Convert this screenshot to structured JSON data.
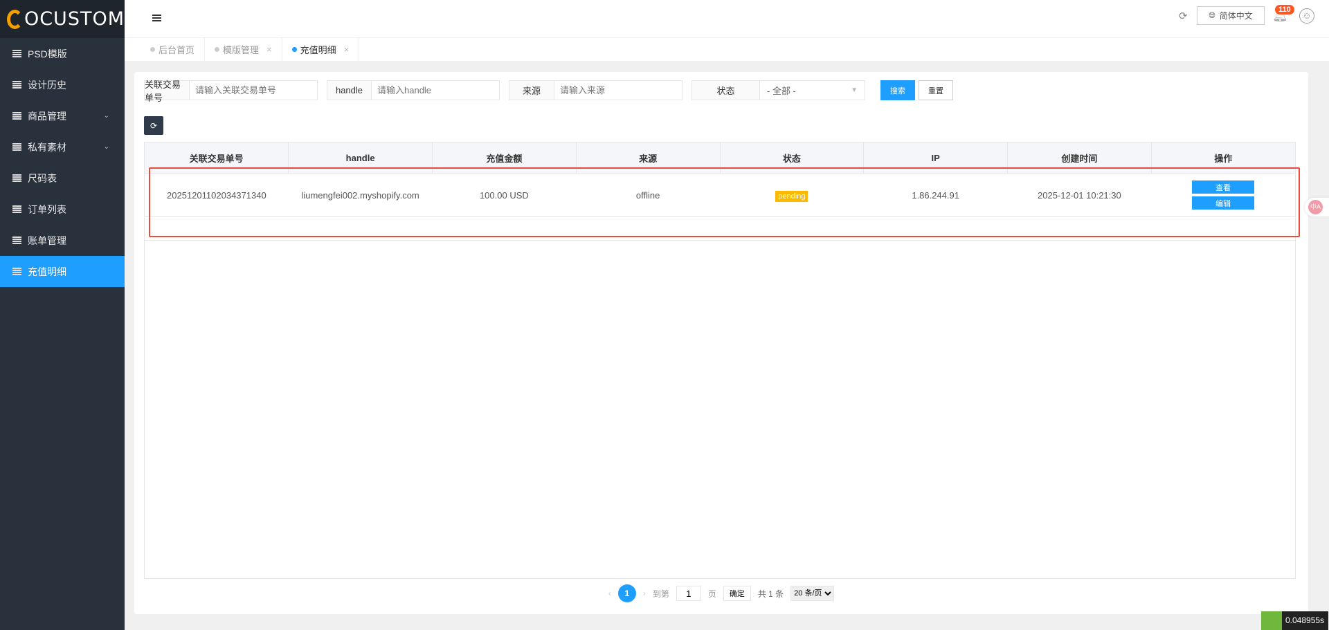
{
  "logo": "OCUSTOM",
  "sidebar": {
    "items": [
      {
        "label": "PSD模版"
      },
      {
        "label": "设计历史"
      },
      {
        "label": "商品管理",
        "chev": "⌄"
      },
      {
        "label": "私有素材",
        "chev": "⌄"
      },
      {
        "label": "尺码表"
      },
      {
        "label": "订单列表"
      },
      {
        "label": "账单管理"
      },
      {
        "label": "充值明细"
      }
    ]
  },
  "header": {
    "lang": "简体中文",
    "badge": "110"
  },
  "tabs": [
    {
      "label": "后台首页"
    },
    {
      "label": "模版管理",
      "close": "×"
    },
    {
      "label": "充值明细",
      "close": "×"
    }
  ],
  "filters": [
    {
      "label": "关联交易单号",
      "placeholder": "请输入关联交易单号"
    },
    {
      "label": "handle",
      "placeholder": "请输入handle"
    },
    {
      "label": "来源",
      "placeholder": "请输入来源"
    },
    {
      "label": "状态",
      "value": "- 全部 -"
    }
  ],
  "buttons": {
    "search": "搜索",
    "reset": "重置"
  },
  "table": {
    "columns": [
      "关联交易单号",
      "handle",
      "充值金额",
      "来源",
      "状态",
      "IP",
      "创建时间",
      "操作"
    ],
    "rows": [
      {
        "order": "20251201102034371340",
        "handle": "liumengfei002.myshopify.com",
        "amount": "100.00 USD",
        "source": "offline",
        "status": "pending",
        "ip": "1.86.244.91",
        "created": "2025-12-01 10:21:30",
        "view": "查看",
        "edit": "编辑"
      }
    ]
  },
  "pager": {
    "current": "1",
    "goto": "到第",
    "page_value": "1",
    "page_unit": "页",
    "confirm": "确定",
    "total": "共 1 条",
    "per_page": "20 条/页"
  },
  "timing": "0.048955s",
  "colors": {
    "primary": "#1e9fff",
    "sidebar": "#28313c",
    "pending": "#ffb800",
    "highlight": "#e74c3c"
  }
}
